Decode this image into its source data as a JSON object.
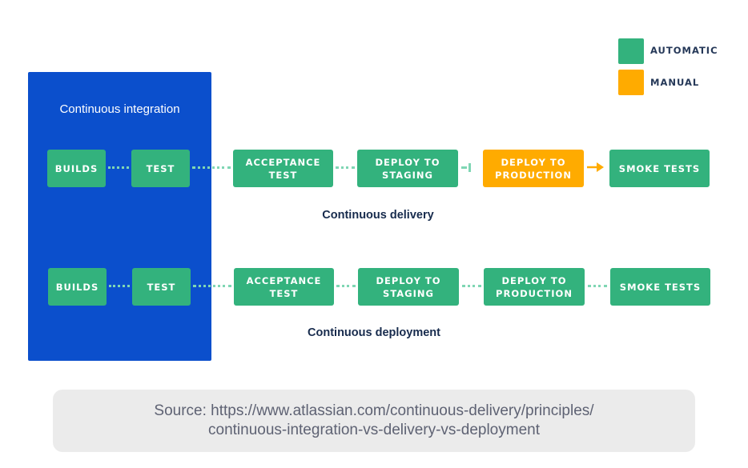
{
  "legend": {
    "items": [
      {
        "label": "AUTOMATIC",
        "color": "#33b27d"
      },
      {
        "label": "MANUAL",
        "color": "#ffab00"
      }
    ]
  },
  "ci": {
    "title": "Continuous integration",
    "color": "#0b4fcc"
  },
  "delivery": {
    "label": "Continuous delivery",
    "steps": [
      {
        "label": "BUILDS",
        "type": "automatic"
      },
      {
        "label": "TEST",
        "type": "automatic"
      },
      {
        "label": "ACCEPTANCE TEST",
        "type": "automatic"
      },
      {
        "label": "DEPLOY TO STAGING",
        "type": "automatic"
      },
      {
        "label": "DEPLOY TO PRODUCTION",
        "type": "manual"
      },
      {
        "label": "SMOKE TESTS",
        "type": "automatic"
      }
    ]
  },
  "deployment": {
    "label": "Continuous deployment",
    "steps": [
      {
        "label": "BUILDS",
        "type": "automatic"
      },
      {
        "label": "TEST",
        "type": "automatic"
      },
      {
        "label": "ACCEPTANCE TEST",
        "type": "automatic"
      },
      {
        "label": "DEPLOY TO STAGING",
        "type": "automatic"
      },
      {
        "label": "DEPLOY TO PRODUCTION",
        "type": "automatic"
      },
      {
        "label": "SMOKE TESTS",
        "type": "automatic"
      }
    ]
  },
  "source": {
    "line1": "Source: https://www.atlassian.com/continuous-delivery/principles/",
    "line2": "continuous-integration-vs-delivery-vs-deployment"
  }
}
